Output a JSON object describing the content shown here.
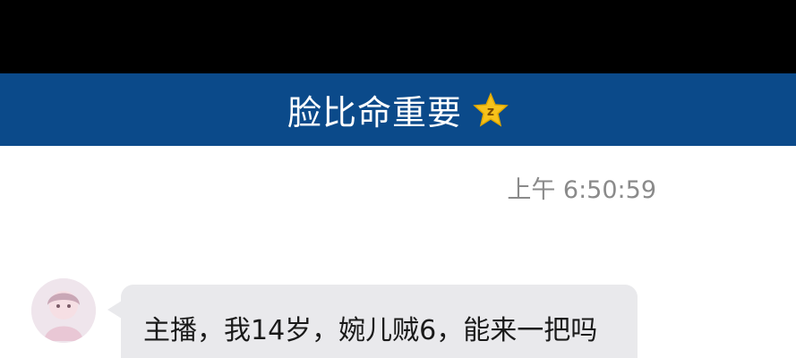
{
  "header": {
    "title": "脸比命重要",
    "badge_icon": "qq-star-z-icon"
  },
  "chat": {
    "timestamp": "上午 6:50:59",
    "messages": [
      {
        "avatar_icon": "user-avatar",
        "text": "主播，我14岁，婉儿贼6，能来一把吗"
      }
    ]
  },
  "colors": {
    "header_bg": "#0b4a8a",
    "bubble_bg": "#e9e9ec",
    "timestamp": "#8a8a8a"
  }
}
